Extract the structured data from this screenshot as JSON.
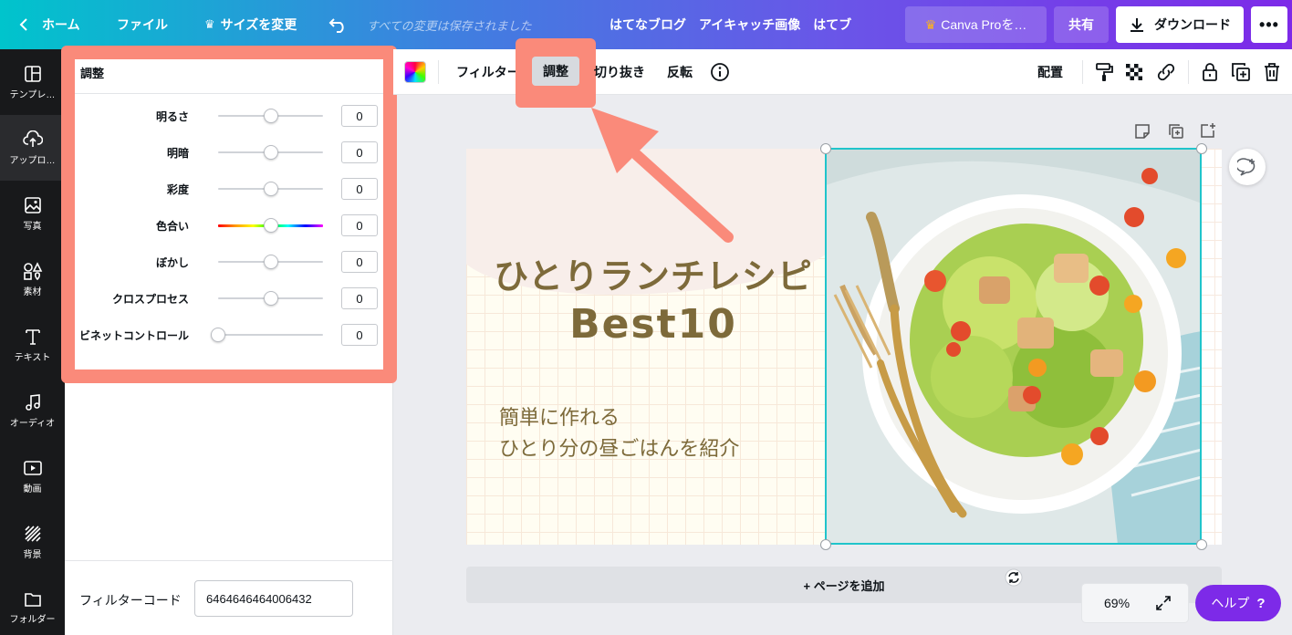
{
  "topbar": {
    "home": "ホーム",
    "file": "ファイル",
    "resize": "サイズを変更",
    "saved_status": "すべての変更は保存されました",
    "doc_title": "はてなブログ　アイキャッチ画像　はてブ",
    "pro": "Canva Proを…",
    "share": "共有",
    "download": "ダウンロード"
  },
  "rail": {
    "items": [
      {
        "label": "テンプレ…",
        "icon": "template-icon"
      },
      {
        "label": "アップロ…",
        "icon": "upload-icon"
      },
      {
        "label": "写真",
        "icon": "photo-icon"
      },
      {
        "label": "素材",
        "icon": "elements-icon"
      },
      {
        "label": "テキスト",
        "icon": "text-icon"
      },
      {
        "label": "オーディオ",
        "icon": "audio-icon"
      },
      {
        "label": "動画",
        "icon": "video-icon"
      },
      {
        "label": "背景",
        "icon": "background-icon"
      },
      {
        "label": "フォルダー",
        "icon": "folder-icon"
      }
    ]
  },
  "panel": {
    "title": "調整",
    "adjustments": [
      {
        "label": "明るさ",
        "value": "0",
        "level": 0.5
      },
      {
        "label": "明暗",
        "value": "0",
        "level": 0.5
      },
      {
        "label": "彩度",
        "value": "0",
        "level": 0.5
      },
      {
        "label": "色合い",
        "value": "0",
        "level": 0.5
      },
      {
        "label": "ぼかし",
        "value": "0",
        "level": 0.5
      },
      {
        "label": "クロスプロセス",
        "value": "0",
        "level": 0.5
      },
      {
        "label": "ビネットコントロール",
        "value": "0",
        "level": 0.0
      }
    ],
    "filter_code_label": "フィルターコード",
    "filter_code_value": "6464646464006432"
  },
  "edit_toolbar": {
    "filter": "フィルター",
    "adjust": "調整",
    "crop": "切り抜き",
    "flip": "反転",
    "arrange": "配置"
  },
  "canvas": {
    "title_line1": "ひとりランチレシピ",
    "title_line2": "Best10",
    "subtitle_line1": "簡単に作れる",
    "subtitle_line2": "ひとり分の昼ごはんを紹介",
    "add_page": "+ ページを追加"
  },
  "footer": {
    "zoom": "69%",
    "help": "ヘルプ"
  },
  "colors": {
    "highlight": "#fa8a7a",
    "accent": "#7d2ae8",
    "selection": "#20c4cb",
    "title_text": "#7d6a3a"
  }
}
